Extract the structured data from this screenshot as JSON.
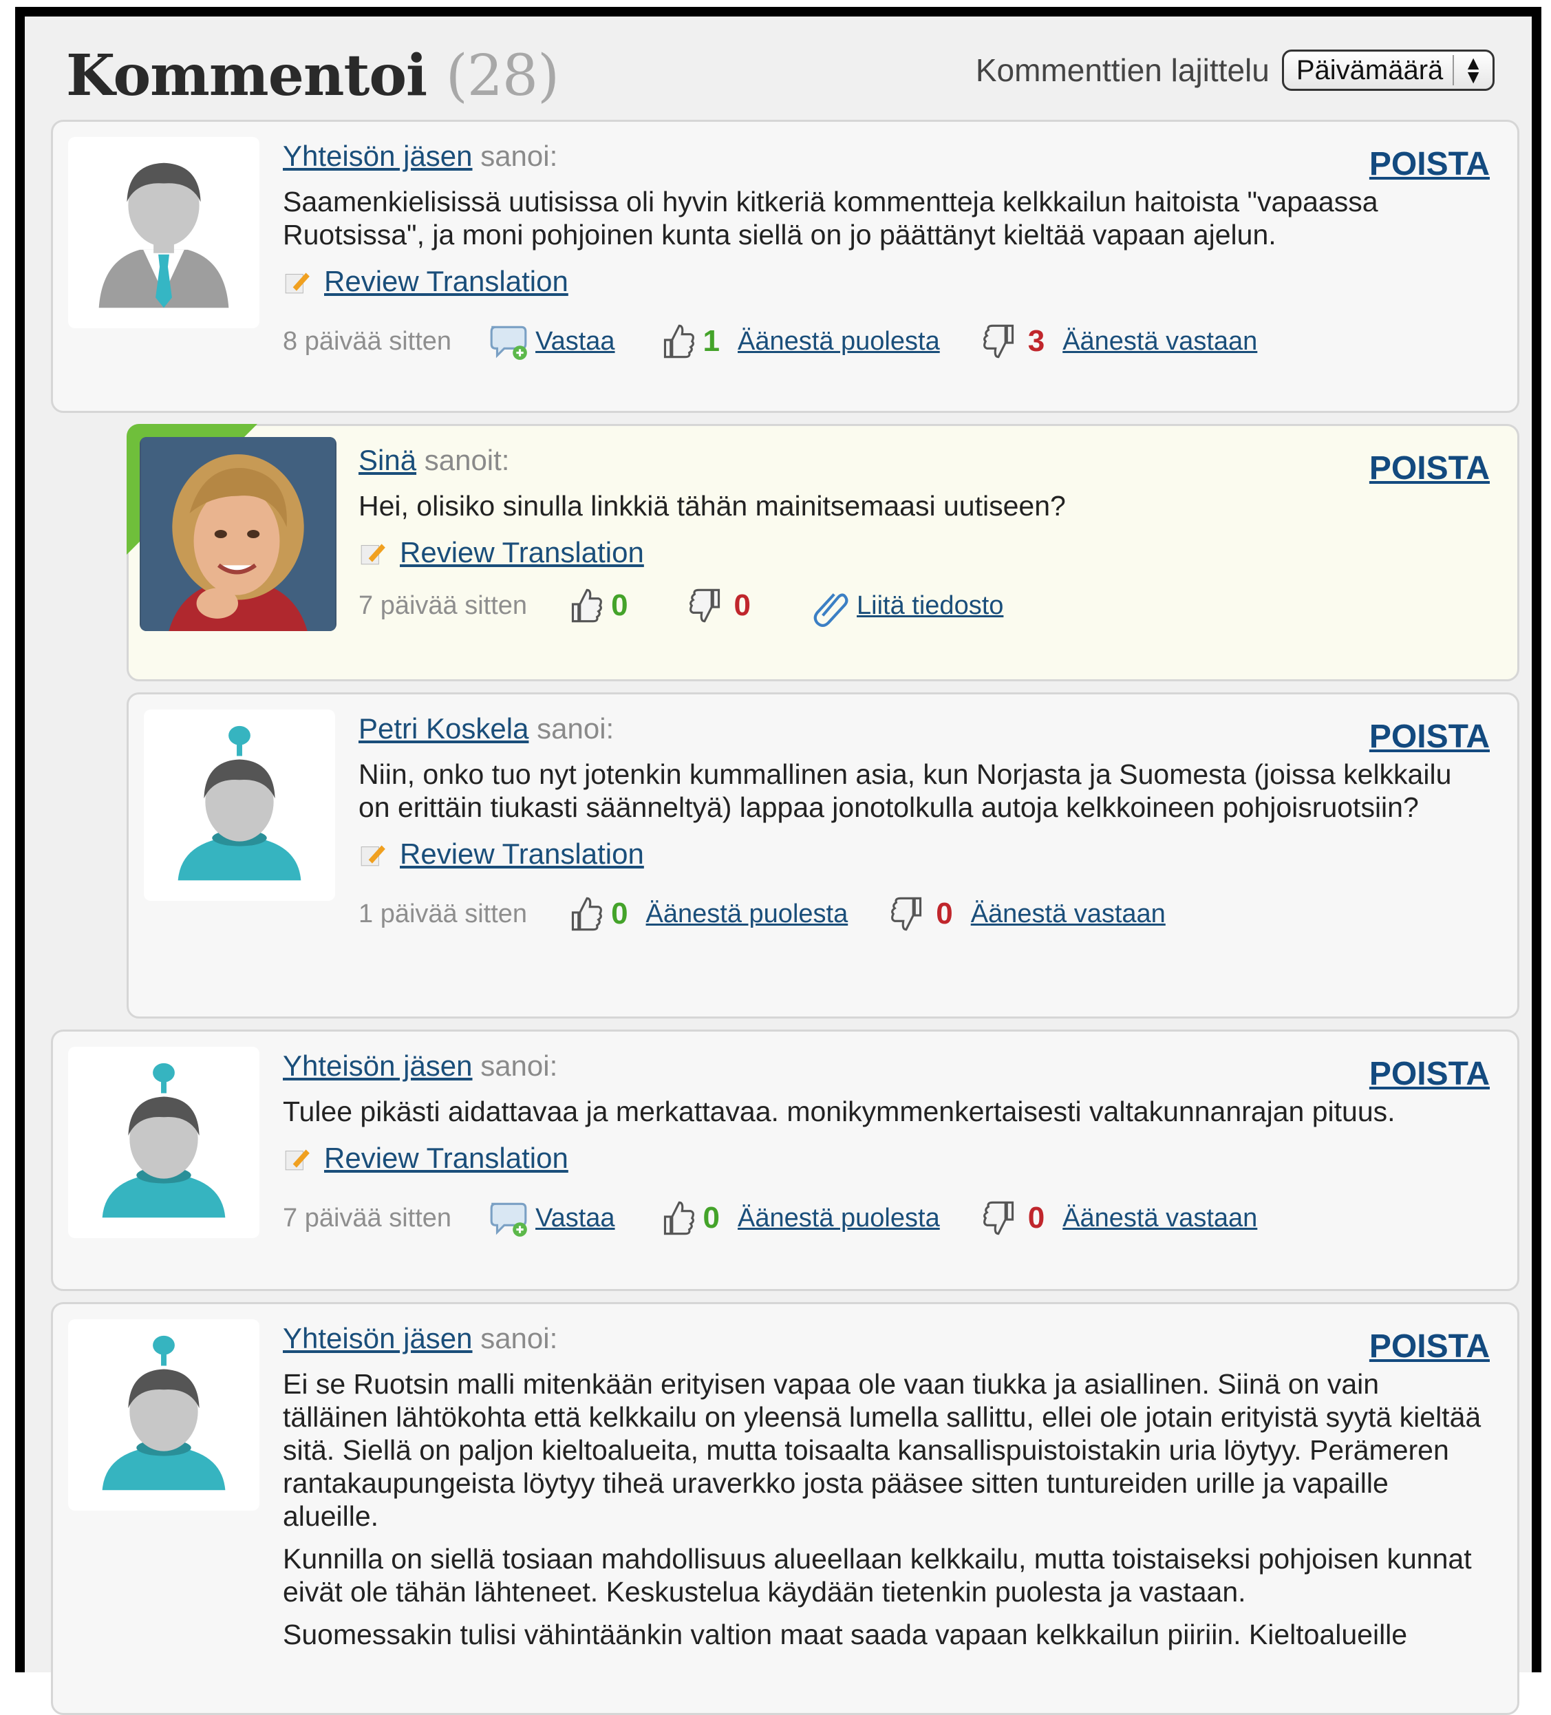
{
  "header": {
    "title": "Kommentoi",
    "count": "(28)",
    "sort_label": "Kommenttien lajittelu",
    "sort_selected": "Päivämäärä"
  },
  "comments": [
    {
      "author": "Yhteisön jäsen",
      "said": "sanoi:",
      "delete": "POISTA",
      "paragraphs": [
        "Saamenkielisissä uutisissa oli hyvin kitkeriä kommentteja kelkkailun haitoista \"vapaassa Ruotsissa\", ja moni pohjoinen kunta siellä on jo päättänyt kieltää vapaan ajelun."
      ],
      "review": "Review Translation",
      "time": "8 päivää sitten",
      "reply": "Vastaa",
      "up_count": "1",
      "up_label": "Äänestä puolesta",
      "down_count": "3",
      "down_label": "Äänestä vastaan"
    },
    {
      "author": "Sinä",
      "said": "sanoit:",
      "delete": "POISTA",
      "paragraphs": [
        "Hei, olisiko sinulla linkkiä tähän mainitsemaasi uutiseen?"
      ],
      "review": "Review Translation",
      "time": "7 päivää sitten",
      "up_count": "0",
      "down_count": "0",
      "attach": "Liitä tiedosto"
    },
    {
      "author": "Petri Koskela",
      "said": "sanoi:",
      "delete": "POISTA",
      "paragraphs": [
        "Niin, onko tuo nyt jotenkin kummallinen asia, kun Norjasta ja Suomesta (joissa kelkkailu on erittäin tiukasti säänneltyä) lappaa jonotolkulla autoja kelkkoineen pohjoisruotsiin?"
      ],
      "review": "Review Translation",
      "time": "1 päivää sitten",
      "up_count": "0",
      "up_label": "Äänestä puolesta",
      "down_count": "0",
      "down_label": "Äänestä vastaan"
    },
    {
      "author": "Yhteisön jäsen",
      "said": "sanoi:",
      "delete": "POISTA",
      "paragraphs": [
        "Tulee pikästi aidattavaa ja merkattavaa. monikymmenkertaisesti valtakunnanrajan pituus."
      ],
      "review": "Review Translation",
      "time": "7 päivää sitten",
      "reply": "Vastaa",
      "up_count": "0",
      "up_label": "Äänestä puolesta",
      "down_count": "0",
      "down_label": "Äänestä vastaan"
    },
    {
      "author": "Yhteisön jäsen",
      "said": "sanoi:",
      "delete": "POISTA",
      "paragraphs": [
        "Ei se Ruotsin malli mitenkään erityisen vapaa ole vaan tiukka ja asiallinen. Siinä on vain tälläinen lähtökohta että kelkkailu on yleensä lumella sallittu, ellei ole jotain erityistä syytä kieltää sitä. Siellä on paljon kieltoalueita, mutta toisaalta kansallispuistoistakin uria löytyy. Perämeren rantakaupungeista löytyy tiheä uraverkko josta pääsee sitten tuntureiden urille ja vapaille alueille.",
        "Kunnilla on siellä tosiaan mahdollisuus alueellaan kelkkailu, mutta toistaiseksi pohjoisen kunnat eivät ole tähän lähteneet. Keskustelua käydään tietenkin puolesta ja vastaan.",
        "Suomessakin tulisi vähintäänkin valtion maat saada vapaan kelkkailun piiriin. Kieltoalueille"
      ]
    }
  ]
}
